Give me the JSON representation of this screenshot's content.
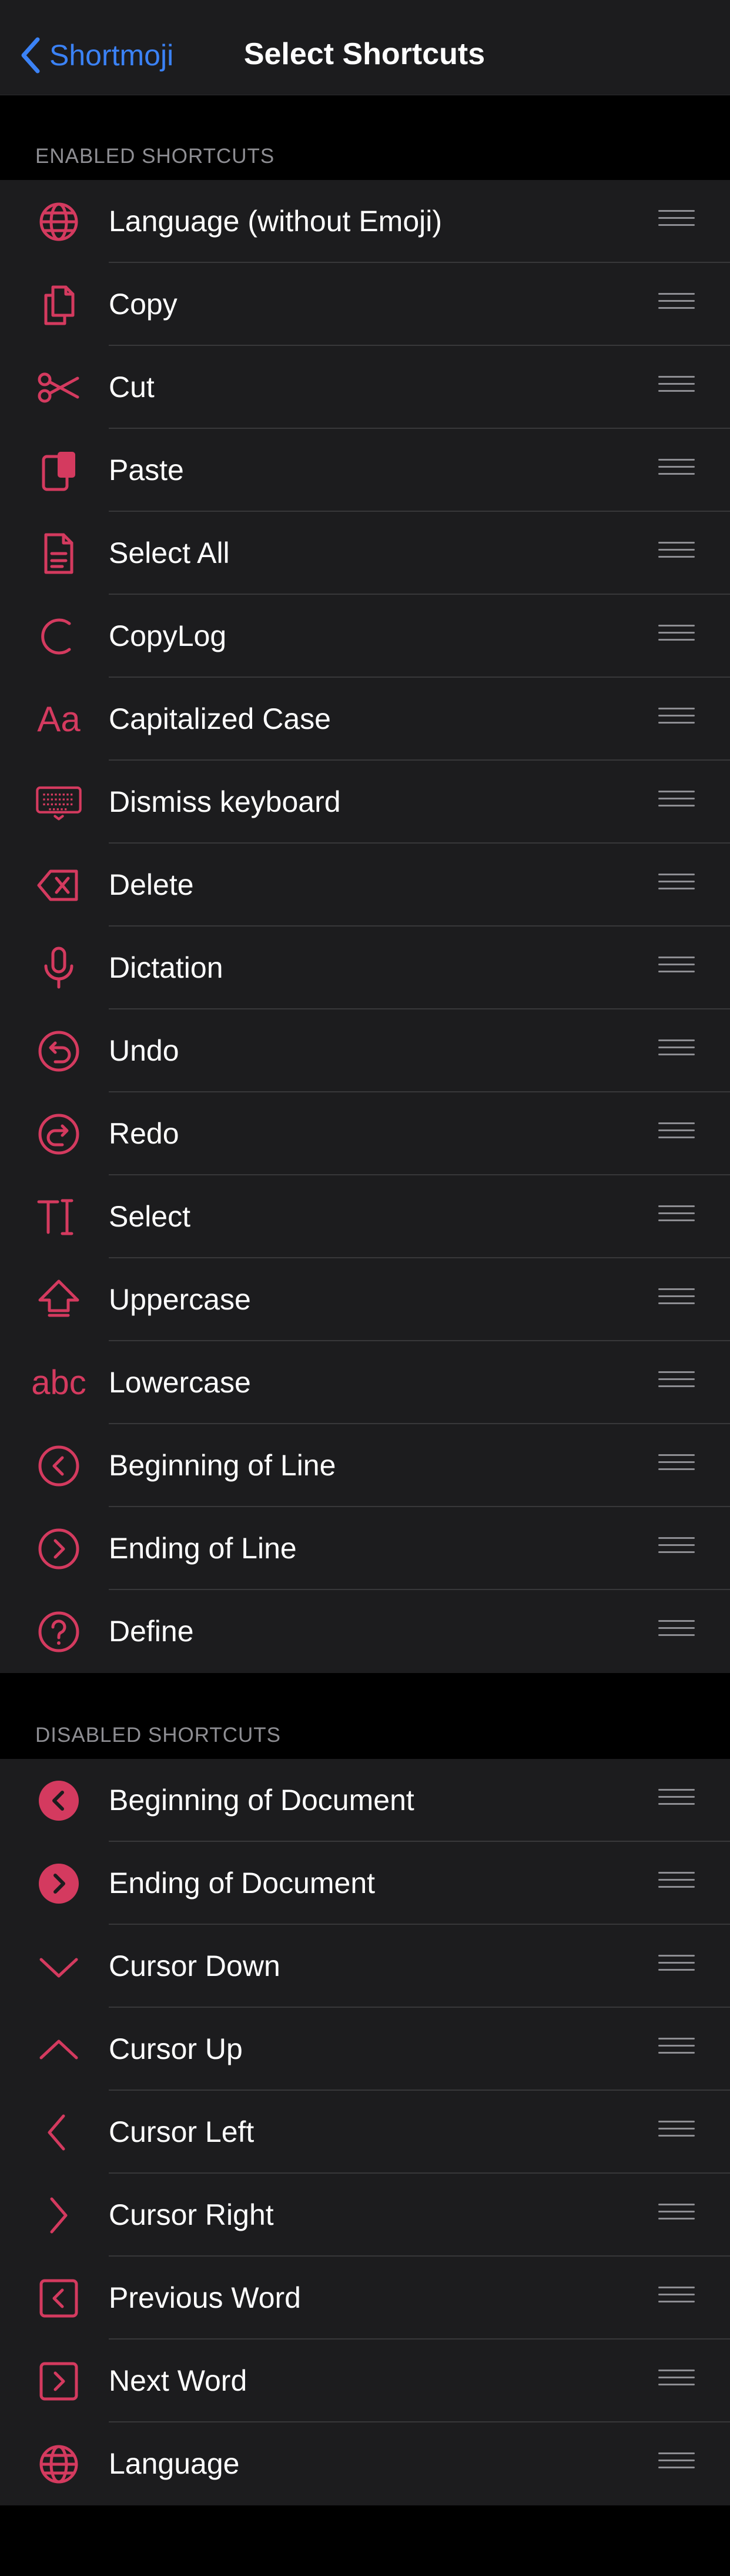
{
  "nav": {
    "back_label": "Shortmoji",
    "title": "Select Shortcuts"
  },
  "colors": {
    "accent": "#d43a5f",
    "link": "#3b82f6",
    "background": "#000000",
    "cell": "#1c1c1e",
    "separator": "#38383a",
    "secondary_text": "#8e8e93"
  },
  "enabled": {
    "header": "ENABLED SHORTCUTS",
    "items": [
      {
        "label": "Language (without Emoji)",
        "icon": "globe-icon"
      },
      {
        "label": "Copy",
        "icon": "copy-icon"
      },
      {
        "label": "Cut",
        "icon": "scissors-icon"
      },
      {
        "label": "Paste",
        "icon": "paste-icon"
      },
      {
        "label": "Select All",
        "icon": "document-icon"
      },
      {
        "label": "CopyLog",
        "icon": "c-letter-icon"
      },
      {
        "label": "Capitalized Case",
        "icon": "aa-icon"
      },
      {
        "label": "Dismiss keyboard",
        "icon": "keyboard-icon"
      },
      {
        "label": "Delete",
        "icon": "delete-backspace-icon"
      },
      {
        "label": "Dictation",
        "icon": "microphone-icon"
      },
      {
        "label": "Undo",
        "icon": "undo-circle-icon"
      },
      {
        "label": "Redo",
        "icon": "redo-circle-icon"
      },
      {
        "label": "Select",
        "icon": "text-cursor-icon"
      },
      {
        "label": "Uppercase",
        "icon": "shift-arrow-icon"
      },
      {
        "label": "Lowercase",
        "icon": "abc-icon"
      },
      {
        "label": "Beginning of Line",
        "icon": "chevron-left-circle-icon"
      },
      {
        "label": "Ending of Line",
        "icon": "chevron-right-circle-icon"
      },
      {
        "label": "Define",
        "icon": "question-circle-icon"
      }
    ]
  },
  "disabled": {
    "header": "DISABLED SHORTCUTS",
    "items": [
      {
        "label": "Beginning of Document",
        "icon": "chevron-left-filled-circle-icon"
      },
      {
        "label": "Ending of Document",
        "icon": "chevron-right-filled-circle-icon"
      },
      {
        "label": "Cursor Down",
        "icon": "chevron-down-icon"
      },
      {
        "label": "Cursor Up",
        "icon": "chevron-up-icon"
      },
      {
        "label": "Cursor Left",
        "icon": "chevron-left-icon"
      },
      {
        "label": "Cursor Right",
        "icon": "chevron-right-icon"
      },
      {
        "label": "Previous Word",
        "icon": "chevron-left-square-icon"
      },
      {
        "label": "Next Word",
        "icon": "chevron-right-square-icon"
      },
      {
        "label": "Language",
        "icon": "globe-icon"
      }
    ]
  }
}
